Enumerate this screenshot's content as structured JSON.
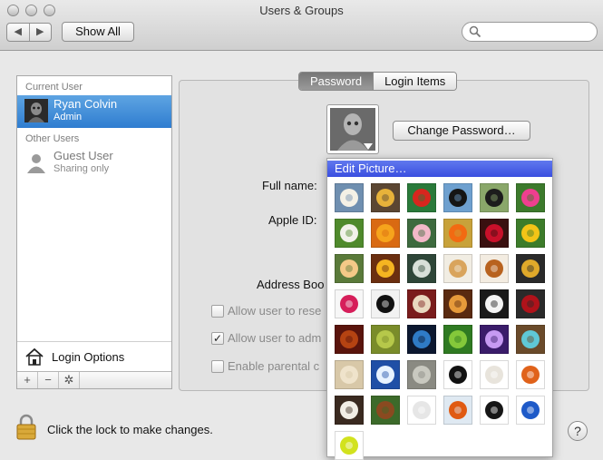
{
  "window": {
    "title": "Users & Groups"
  },
  "toolbar": {
    "back": "◀",
    "forward": "▶",
    "show_all": "Show All",
    "search_placeholder": ""
  },
  "sidebar": {
    "current_user_header": "Current User",
    "current_user": {
      "name": "Ryan Colvin",
      "role": "Admin"
    },
    "other_users_header": "Other Users",
    "other_users": [
      {
        "name": "Guest User",
        "role": "Sharing only"
      }
    ],
    "login_options": "Login Options",
    "add": "+",
    "remove": "−",
    "action": "✲"
  },
  "tabs": [
    {
      "label": "Password",
      "active": true
    },
    {
      "label": "Login Items",
      "active": false
    }
  ],
  "form": {
    "change_password": "Change Password…",
    "full_name_label": "Full name:",
    "apple_id_label": "Apple ID:",
    "address_book_label": "Address Boo",
    "checkboxes": [
      {
        "label": "Allow user to rese",
        "checked": false
      },
      {
        "label": "Allow user to adm",
        "checked": true
      },
      {
        "label": "Enable parental c",
        "checked": false
      }
    ]
  },
  "footer": {
    "lock_message": "Click the lock to make changes.",
    "help": "?"
  },
  "picture_menu": {
    "header": "Edit Picture…",
    "highlight_color": "#3d52e2",
    "pictures": [
      {
        "name": "eagle",
        "bg": "#6f8fb0",
        "fg": "#f4f1e6"
      },
      {
        "name": "owl",
        "bg": "#5b4632",
        "fg": "#e7b23a"
      },
      {
        "name": "parrot",
        "bg": "#2a7a3a",
        "fg": "#d7261e"
      },
      {
        "name": "penguin",
        "bg": "#6ea0cf",
        "fg": "#151515"
      },
      {
        "name": "zebra",
        "bg": "#8aa76a",
        "fg": "#1c1c1c"
      },
      {
        "name": "pink-flower",
        "bg": "#3c7a2c",
        "fg": "#ee3f8f"
      },
      {
        "name": "dandelion",
        "bg": "#4f8a2c",
        "fg": "#f2f2ea"
      },
      {
        "name": "orange-flower",
        "bg": "#d96a12",
        "fg": "#f6a41c"
      },
      {
        "name": "lotus",
        "bg": "#3d6a3e",
        "fg": "#f2b8c8"
      },
      {
        "name": "poppy",
        "bg": "#c8a23a",
        "fg": "#f26a12"
      },
      {
        "name": "red-rose",
        "bg": "#3a1010",
        "fg": "#c8102a"
      },
      {
        "name": "sunflower",
        "bg": "#3c7c2a",
        "fg": "#f3c417"
      },
      {
        "name": "yellow-rose",
        "bg": "#5a7a3a",
        "fg": "#f4c987"
      },
      {
        "name": "daisy",
        "bg": "#6b2f10",
        "fg": "#f5b521"
      },
      {
        "name": "chalkboard",
        "bg": "#2e4638",
        "fg": "#d8e0d8"
      },
      {
        "name": "fortune-cookie",
        "bg": "#f1ede3",
        "fg": "#d9a45c"
      },
      {
        "name": "gingerbread",
        "bg": "#f3ece1",
        "fg": "#b8621e"
      },
      {
        "name": "medal",
        "bg": "#2a2a2a",
        "fg": "#e0a92a"
      },
      {
        "name": "lips",
        "bg": "#f7f7f7",
        "fg": "#d61e5a"
      },
      {
        "name": "yin-yang",
        "bg": "#f2f2f2",
        "fg": "#111111"
      },
      {
        "name": "drum",
        "bg": "#7a1c1c",
        "fg": "#e9d9c0"
      },
      {
        "name": "guitar",
        "bg": "#5a2a10",
        "fg": "#e69a3a"
      },
      {
        "name": "piano",
        "bg": "#1a1a1a",
        "fg": "#f4f4f4"
      },
      {
        "name": "record",
        "bg": "#2a2a2a",
        "fg": "#b0121a"
      },
      {
        "name": "violin",
        "bg": "#5a140c",
        "fg": "#b54312"
      },
      {
        "name": "leaf",
        "bg": "#7a8c2a",
        "fg": "#b6c84a"
      },
      {
        "name": "earth",
        "bg": "#0c1830",
        "fg": "#2f7bc6"
      },
      {
        "name": "green-leaf",
        "bg": "#2f7a22",
        "fg": "#84c83a"
      },
      {
        "name": "lightning",
        "bg": "#3a1c6a",
        "fg": "#c69af2"
      },
      {
        "name": "nest",
        "bg": "#6a4a2a",
        "fg": "#5fc8d6"
      },
      {
        "name": "sand-dollar",
        "bg": "#d8c8a8",
        "fg": "#efe3cb"
      },
      {
        "name": "snowflake",
        "bg": "#1f4fa6",
        "fg": "#e8f3ff"
      },
      {
        "name": "zen-sand",
        "bg": "#8a8a82",
        "fg": "#c9c9c0"
      },
      {
        "name": "8-ball",
        "bg": "#ffffff",
        "fg": "#111111"
      },
      {
        "name": "baseball",
        "bg": "#ffffff",
        "fg": "#e8e4dc"
      },
      {
        "name": "basketball",
        "bg": "#ffffff",
        "fg": "#e0621a"
      },
      {
        "name": "bowling",
        "bg": "#3a2a20",
        "fg": "#f2eee6"
      },
      {
        "name": "football",
        "bg": "#3c6a2a",
        "fg": "#8a4a20"
      },
      {
        "name": "golf-ball",
        "bg": "#ffffff",
        "fg": "#e6e6e6"
      },
      {
        "name": "hockey",
        "bg": "#dfe9f2",
        "fg": "#e05a12"
      },
      {
        "name": "soccer",
        "bg": "#ffffff",
        "fg": "#161616"
      },
      {
        "name": "target",
        "bg": "#ffffff",
        "fg": "#1e5ac8"
      },
      {
        "name": "tennis",
        "bg": "#ffffff",
        "fg": "#d2e21e"
      }
    ]
  }
}
